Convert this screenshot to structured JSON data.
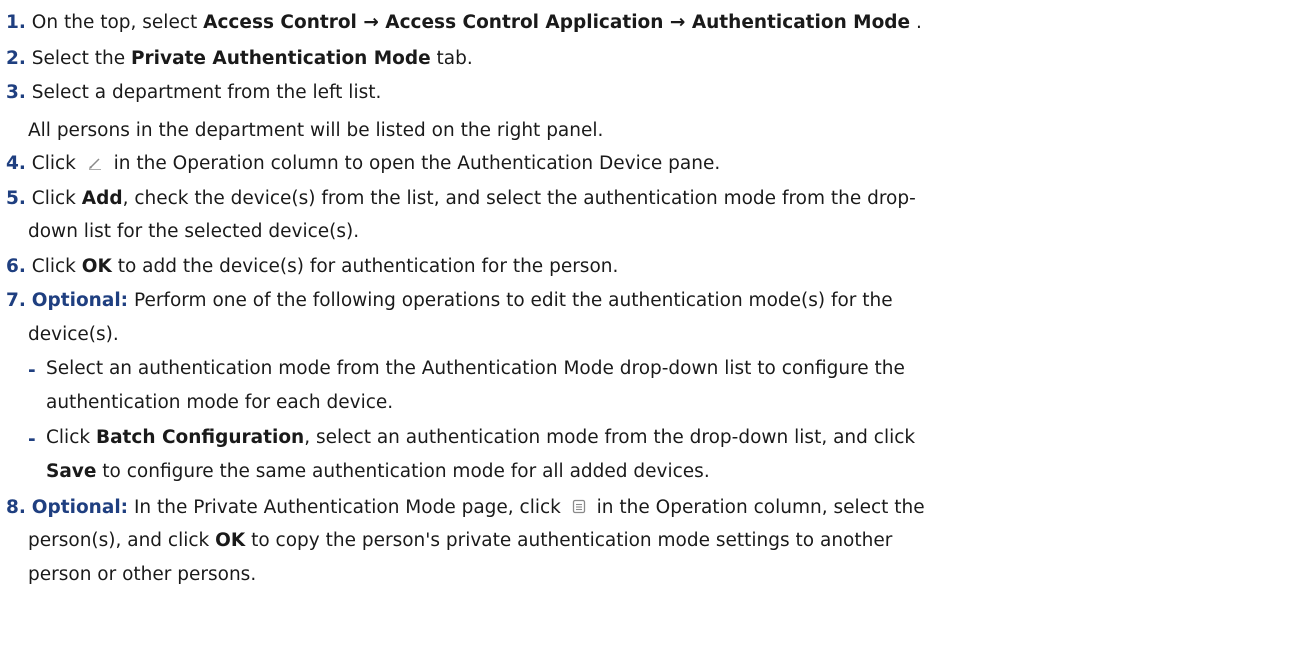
{
  "steps": [
    {
      "num": "1.",
      "t1": "On the top, select ",
      "b1": "Access Control → Access Control Application → Authentication Mode",
      "t2": " ."
    },
    {
      "num": "2.",
      "t1": "Select the ",
      "b1": "Private Authentication Mode",
      "t2": " tab."
    },
    {
      "num": "3.",
      "t1": "Select a department from the left list.",
      "result": "All persons in the department will be listed on the right panel."
    },
    {
      "num": "4.",
      "t1": "Click ",
      "icon": "edit-pencil-icon",
      "t2": " in the Operation column to open the Authentication Device pane."
    },
    {
      "num": "5.",
      "t1": "Click ",
      "b1": "Add",
      "t2": ", check the device(s) from the list, and select the authentication mode from the drop-",
      "t3": "down list for the selected device(s)."
    },
    {
      "num": "6.",
      "t1": "Click ",
      "b1": "OK",
      "t2": " to add the device(s) for authentication for the person."
    },
    {
      "num": "7.",
      "label": "Optional:",
      "t1": " Perform one of the following operations to edit the authentication mode(s) for the",
      "t2": "device(s).",
      "bullets": [
        {
          "dash": "-",
          "l1": "Select an authentication mode from the Authentication Mode drop-down list to configure the",
          "l2": "authentication mode for each device."
        },
        {
          "dash": "-",
          "a": "Click ",
          "b": "Batch Configuration",
          "c": ", select an authentication mode from the drop-down list, and click",
          "d": "Save",
          "e": " to configure the same authentication mode for all added devices."
        }
      ]
    },
    {
      "num": "8.",
      "label": "Optional:",
      "t1": " In the Private Authentication Mode page, click ",
      "icon": "copy-document-icon",
      "t2": " in the Operation column, select the",
      "t3": "person(s), and click ",
      "b1": "OK",
      "t4": " to copy the person's private authentication mode settings to another",
      "t5": "person or other persons."
    }
  ]
}
